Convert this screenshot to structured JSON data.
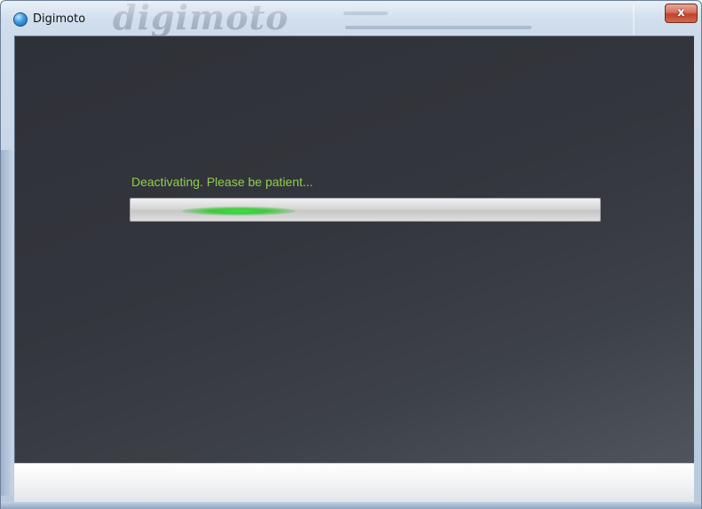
{
  "window": {
    "title": "Digimoto",
    "icon": "digimoto-app-icon",
    "close_label": "x"
  },
  "background_app": {
    "logo_text": "digimoto"
  },
  "status": {
    "message": "Deactivating. Please be patient...",
    "text_color": "#8fcf4c"
  },
  "progress": {
    "type": "indeterminate",
    "glow_color": "#3ce63c"
  },
  "colors": {
    "client_background": "#33363c",
    "close_button": "#c2412b"
  }
}
